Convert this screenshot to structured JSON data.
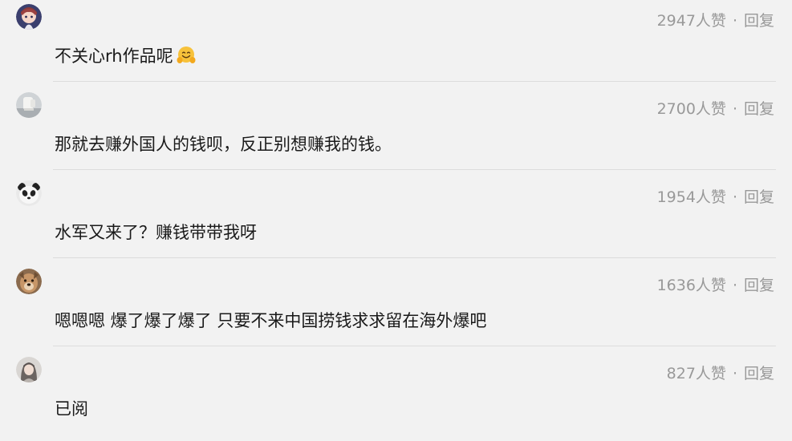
{
  "comments": [
    {
      "avatar_icon": "avatar-anime-girl",
      "likes": "2947",
      "likes_unit": "人赞",
      "separator": "·",
      "reply": "回复",
      "text": "不关心rh作品呢",
      "emoji": "hugging-face-emoji"
    },
    {
      "avatar_icon": "avatar-white-object",
      "likes": "2700",
      "likes_unit": "人赞",
      "separator": "·",
      "reply": "回复",
      "text": "那就去赚外国人的钱呗，反正别想赚我的钱。"
    },
    {
      "avatar_icon": "avatar-panda",
      "likes": "1954",
      "likes_unit": "人赞",
      "separator": "·",
      "reply": "回复",
      "text": "水军又来了？赚钱带带我呀"
    },
    {
      "avatar_icon": "avatar-dog",
      "likes": "1636",
      "likes_unit": "人赞",
      "separator": "·",
      "reply": "回复",
      "text": "嗯嗯嗯 爆了爆了爆了 只要不来中国捞钱求求留在海外爆吧"
    },
    {
      "avatar_icon": "avatar-person",
      "likes": "827",
      "likes_unit": "人赞",
      "separator": "·",
      "reply": "回复",
      "text": "已阅"
    }
  ],
  "colors": {
    "background": "#f2f2f2",
    "meta_text": "#999999",
    "body_text": "#1a1a1a",
    "divider": "#dcdcdc"
  }
}
